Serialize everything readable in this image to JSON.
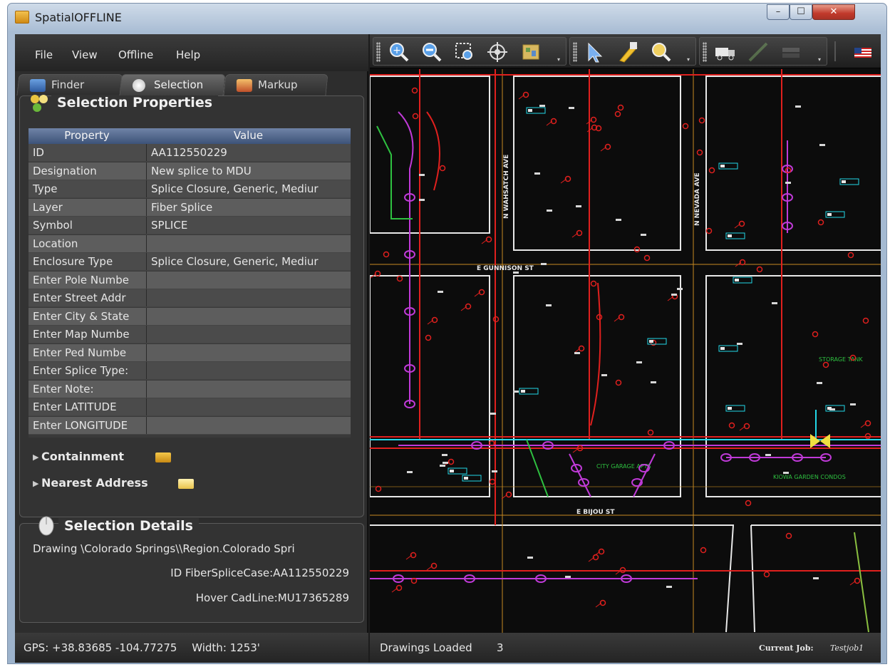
{
  "window": {
    "title": "SpatialOFFLINE",
    "min": "–",
    "max": "☐",
    "close": "✕"
  },
  "menu": [
    "File",
    "View",
    "Offline",
    "Help"
  ],
  "tabs": [
    {
      "label": "Finder",
      "active": false
    },
    {
      "label": "Selection",
      "active": true
    },
    {
      "label": "Markup",
      "active": false
    }
  ],
  "selection_properties": {
    "title": "Selection Properties",
    "columns": [
      "Property",
      "Value"
    ],
    "rows": [
      {
        "property": "ID",
        "value": "AA112550229"
      },
      {
        "property": "Designation",
        "value": "New splice to MDU"
      },
      {
        "property": "Type",
        "value": "Splice Closure, Generic, Mediur"
      },
      {
        "property": "Layer",
        "value": "Fiber Splice"
      },
      {
        "property": "Symbol",
        "value": "SPLICE"
      },
      {
        "property": "Location",
        "value": ""
      },
      {
        "property": "Enclosure Type",
        "value": "Splice Closure, Generic, Mediur"
      },
      {
        "property": "Enter Pole Numbe",
        "value": ""
      },
      {
        "property": "Enter Street Addr",
        "value": ""
      },
      {
        "property": "Enter City & State",
        "value": ""
      },
      {
        "property": "Enter Map Numbe",
        "value": ""
      },
      {
        "property": "Enter Ped Numbe",
        "value": ""
      },
      {
        "property": "Enter Splice Type:",
        "value": ""
      },
      {
        "property": "Enter Note:",
        "value": ""
      },
      {
        "property": "Enter LATITUDE",
        "value": ""
      },
      {
        "property": "Enter LONGITUDE",
        "value": ""
      }
    ],
    "expanders": [
      "Containment",
      "Nearest Address"
    ]
  },
  "selection_details": {
    "title": "Selection Details",
    "drawing": "Drawing \\Colorado Springs\\\\Region.Colorado Spri",
    "id": "ID FiberSpliceCase:AA112550229",
    "hover": "Hover CadLine:MU17365289"
  },
  "status_left": {
    "gps": "GPS: +38.83685 -104.77275",
    "width": "Width: 1253'"
  },
  "status_right": {
    "drawings_label": "Drawings Loaded",
    "drawings_count": "3",
    "job_label": "Current Job:",
    "job_value": "Testjob1"
  },
  "map": {
    "streets": [
      "E GUNNISON ST",
      "E BIJOU ST",
      "N WAHSATCH AVE",
      "N NEVADA AVE"
    ],
    "labels": [
      "STORAGE TANK",
      "CITY GARAGE APTS",
      "KIOWA GARDEN CONDOS"
    ],
    "colors": {
      "fiber": "#e0201e",
      "splice": "#c03ad8",
      "boundary": "#e8e8e8",
      "cyan": "#22d8e8",
      "road": "#c88a22"
    }
  },
  "toolbar": {
    "group1": [
      "zoom-in-icon",
      "zoom-out-icon",
      "zoom-window-icon",
      "gps-target-icon",
      "map-layers-icon"
    ],
    "group2": [
      "select-icon",
      "pan-icon",
      "identify-icon"
    ],
    "group3": [
      "truck-icon",
      "measure-icon",
      "redline-icon"
    ],
    "flag": "us-flag-icon"
  }
}
